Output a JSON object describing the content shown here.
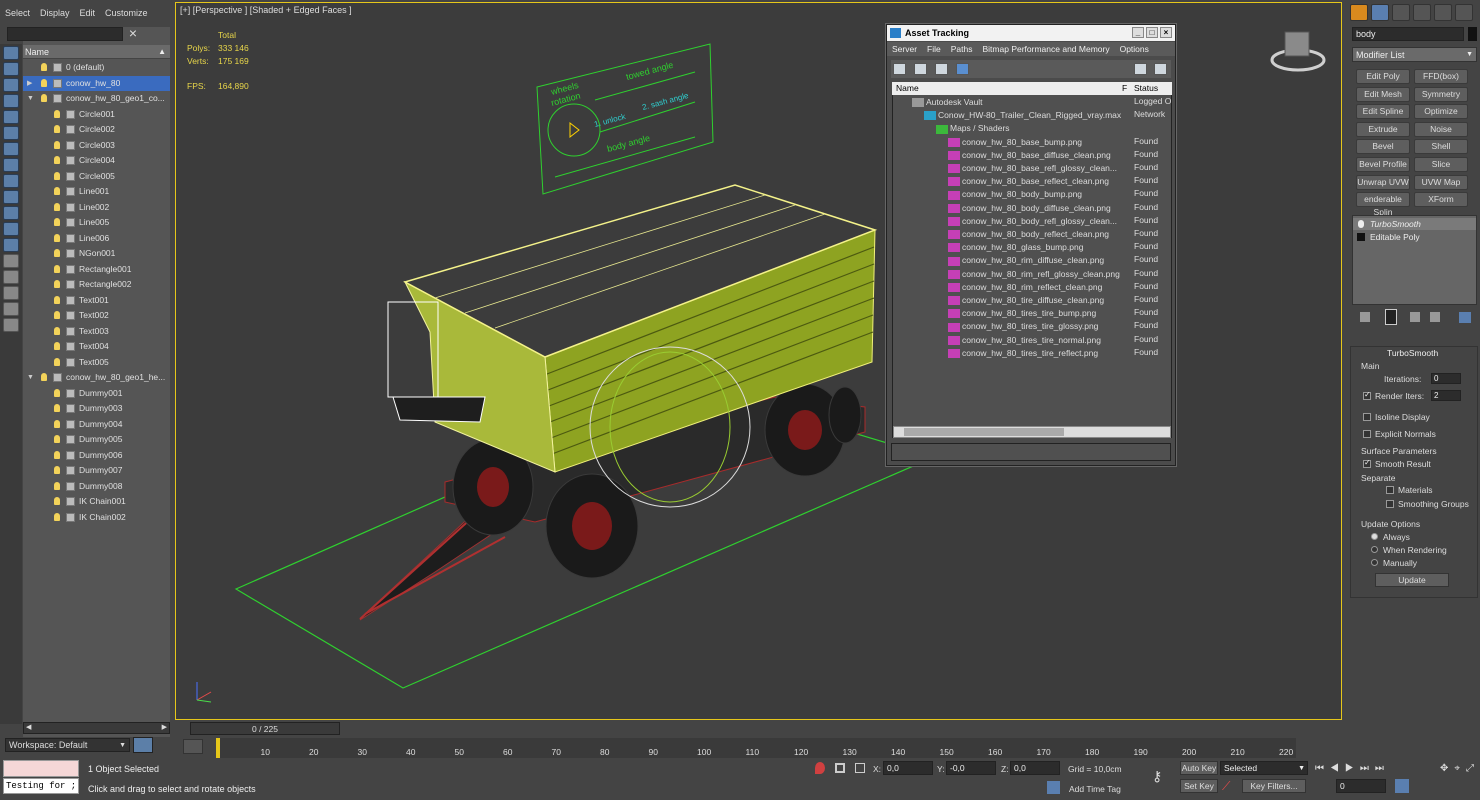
{
  "menu": [
    "Select",
    "Display",
    "Edit",
    "Customize"
  ],
  "explorer": {
    "column_name": "Name",
    "rows": [
      {
        "label": "0 (default)",
        "type": "layer",
        "indent": 0,
        "selected": false
      },
      {
        "label": "conow_hw_80",
        "type": "layer",
        "indent": 0,
        "selected": true
      },
      {
        "label": "conow_hw_80_geo1_co...",
        "type": "layer",
        "indent": 0,
        "selected": false
      },
      {
        "label": "Circle001",
        "type": "obj",
        "indent": 1,
        "selected": false
      },
      {
        "label": "Circle002",
        "type": "obj",
        "indent": 1,
        "selected": false
      },
      {
        "label": "Circle003",
        "type": "obj",
        "indent": 1,
        "selected": false
      },
      {
        "label": "Circle004",
        "type": "obj",
        "indent": 1,
        "selected": false
      },
      {
        "label": "Circle005",
        "type": "obj",
        "indent": 1,
        "selected": false
      },
      {
        "label": "Line001",
        "type": "obj",
        "indent": 1,
        "selected": false
      },
      {
        "label": "Line002",
        "type": "obj",
        "indent": 1,
        "selected": false
      },
      {
        "label": "Line005",
        "type": "obj",
        "indent": 1,
        "selected": false
      },
      {
        "label": "Line006",
        "type": "obj",
        "indent": 1,
        "selected": false
      },
      {
        "label": "NGon001",
        "type": "obj",
        "indent": 1,
        "selected": false
      },
      {
        "label": "Rectangle001",
        "type": "obj",
        "indent": 1,
        "selected": false
      },
      {
        "label": "Rectangle002",
        "type": "obj",
        "indent": 1,
        "selected": false
      },
      {
        "label": "Text001",
        "type": "obj",
        "indent": 1,
        "selected": false
      },
      {
        "label": "Text002",
        "type": "obj",
        "indent": 1,
        "selected": false
      },
      {
        "label": "Text003",
        "type": "obj",
        "indent": 1,
        "selected": false
      },
      {
        "label": "Text004",
        "type": "obj",
        "indent": 1,
        "selected": false
      },
      {
        "label": "Text005",
        "type": "obj",
        "indent": 1,
        "selected": false
      },
      {
        "label": "conow_hw_80_geo1_he...",
        "type": "layer",
        "indent": 0,
        "selected": false
      },
      {
        "label": "Dummy001",
        "type": "obj",
        "indent": 1,
        "selected": false
      },
      {
        "label": "Dummy003",
        "type": "obj",
        "indent": 1,
        "selected": false
      },
      {
        "label": "Dummy004",
        "type": "obj",
        "indent": 1,
        "selected": false
      },
      {
        "label": "Dummy005",
        "type": "obj",
        "indent": 1,
        "selected": false
      },
      {
        "label": "Dummy006",
        "type": "obj",
        "indent": 1,
        "selected": false
      },
      {
        "label": "Dummy007",
        "type": "obj",
        "indent": 1,
        "selected": false
      },
      {
        "label": "Dummy008",
        "type": "obj",
        "indent": 1,
        "selected": false
      },
      {
        "label": "IK Chain001",
        "type": "obj",
        "indent": 1,
        "selected": false
      },
      {
        "label": "IK Chain002",
        "type": "obj",
        "indent": 1,
        "selected": false
      }
    ],
    "workspace": "Workspace: Default"
  },
  "viewport": {
    "label": "[+] [Perspective ] [Shaded + Edged Faces ]",
    "stats": {
      "total_label": "Total",
      "polys_label": "Polys:",
      "polys": "333 146",
      "verts_label": "Verts:",
      "verts": "175 169",
      "fps_label": "FPS:",
      "fps": "164,890"
    },
    "gizmo_texts": {
      "wheels": "wheels",
      "rotation": "rotation",
      "towed": "towed angle",
      "unlock": "1. unlock",
      "sash": "2. sash angle",
      "body": "body angle"
    }
  },
  "asset_tracking": {
    "title": "Asset Tracking",
    "menu": [
      "Server",
      "File",
      "Paths",
      "Bitmap Performance and Memory",
      "Options"
    ],
    "col_name": "Name",
    "col_f": "F",
    "col_status": "Status",
    "rows": [
      {
        "name": "Autodesk Vault",
        "status": "Logged O",
        "indent": 0,
        "kind": "vault"
      },
      {
        "name": "Conow_HW-80_Trailer_Clean_Rigged_vray.max",
        "status": "Network",
        "indent": 1,
        "kind": "max"
      },
      {
        "name": "Maps / Shaders",
        "status": "",
        "indent": 2,
        "kind": "maps"
      },
      {
        "name": "conow_hw_80_base_bump.png",
        "status": "Found",
        "indent": 3,
        "kind": "png"
      },
      {
        "name": "conow_hw_80_base_diffuse_clean.png",
        "status": "Found",
        "indent": 3,
        "kind": "png"
      },
      {
        "name": "conow_hw_80_base_refl_glossy_clean...",
        "status": "Found",
        "indent": 3,
        "kind": "png"
      },
      {
        "name": "conow_hw_80_base_reflect_clean.png",
        "status": "Found",
        "indent": 3,
        "kind": "png"
      },
      {
        "name": "conow_hw_80_body_bump.png",
        "status": "Found",
        "indent": 3,
        "kind": "png"
      },
      {
        "name": "conow_hw_80_body_diffuse_clean.png",
        "status": "Found",
        "indent": 3,
        "kind": "png"
      },
      {
        "name": "conow_hw_80_body_refl_glossy_clean...",
        "status": "Found",
        "indent": 3,
        "kind": "png"
      },
      {
        "name": "conow_hw_80_body_reflect_clean.png",
        "status": "Found",
        "indent": 3,
        "kind": "png"
      },
      {
        "name": "conow_hw_80_glass_bump.png",
        "status": "Found",
        "indent": 3,
        "kind": "png"
      },
      {
        "name": "conow_hw_80_rim_diffuse_clean.png",
        "status": "Found",
        "indent": 3,
        "kind": "png"
      },
      {
        "name": "conow_hw_80_rim_refl_glossy_clean.png",
        "status": "Found",
        "indent": 3,
        "kind": "png"
      },
      {
        "name": "conow_hw_80_rim_reflect_clean.png",
        "status": "Found",
        "indent": 3,
        "kind": "png"
      },
      {
        "name": "conow_hw_80_tire_diffuse_clean.png",
        "status": "Found",
        "indent": 3,
        "kind": "png"
      },
      {
        "name": "conow_hw_80_tires_tire_bump.png",
        "status": "Found",
        "indent": 3,
        "kind": "png"
      },
      {
        "name": "conow_hw_80_tires_tire_glossy.png",
        "status": "Found",
        "indent": 3,
        "kind": "png"
      },
      {
        "name": "conow_hw_80_tires_tire_normal.png",
        "status": "Found",
        "indent": 3,
        "kind": "png"
      },
      {
        "name": "conow_hw_80_tires_tire_reflect.png",
        "status": "Found",
        "indent": 3,
        "kind": "png"
      }
    ]
  },
  "command_panel": {
    "object_name": "body",
    "modifier_list": "Modifier List",
    "modifier_buttons": [
      "Edit Poly",
      "FFD(box)",
      "Edit Mesh",
      "Symmetry",
      "Edit Spline",
      "Optimize",
      "Extrude",
      "Noise",
      "Bevel",
      "Shell",
      "Bevel Profile",
      "Slice",
      "Unwrap UVW",
      "UVW Map",
      "enderable Splin",
      "XForm"
    ],
    "stack": [
      "TurboSmooth",
      "Editable Poly"
    ],
    "rollout_title": "TurboSmooth",
    "main_label": "Main",
    "iterations_label": "Iterations:",
    "iterations": "0",
    "render_iters_label": "Render Iters:",
    "render_iters": "2",
    "isoline": "Isoline Display",
    "explicit": "Explicit Normals",
    "surface_label": "Surface Parameters",
    "smooth_result": "Smooth Result",
    "separate_label": "Separate",
    "materials": "Materials",
    "smoothing_groups": "Smoothing Groups",
    "update_options": "Update Options",
    "always": "Always",
    "when_rendering": "When Rendering",
    "manually": "Manually",
    "update_btn": "Update"
  },
  "timeline": {
    "slider": "0 / 225",
    "ticks": [
      "0",
      "10",
      "20",
      "30",
      "40",
      "50",
      "60",
      "70",
      "80",
      "90",
      "100",
      "110",
      "120",
      "130",
      "140",
      "150",
      "160",
      "170",
      "180",
      "190",
      "200",
      "210",
      "220"
    ]
  },
  "status": {
    "maxscript": "Testing for ;",
    "selected": "1 Object Selected",
    "prompt": "Click and drag to select and rotate objects",
    "x_label": "X:",
    "x": "0,0",
    "y_label": "Y:",
    "y": "-0,0",
    "z_label": "Z:",
    "z": "0,0",
    "grid": "Grid = 10,0cm",
    "add_time_tag": "Add Time Tag",
    "auto_key": "Auto Key",
    "set_key": "Set Key",
    "selected_dropdown": "Selected",
    "key_filters": "Key Filters...",
    "frame": "0"
  }
}
